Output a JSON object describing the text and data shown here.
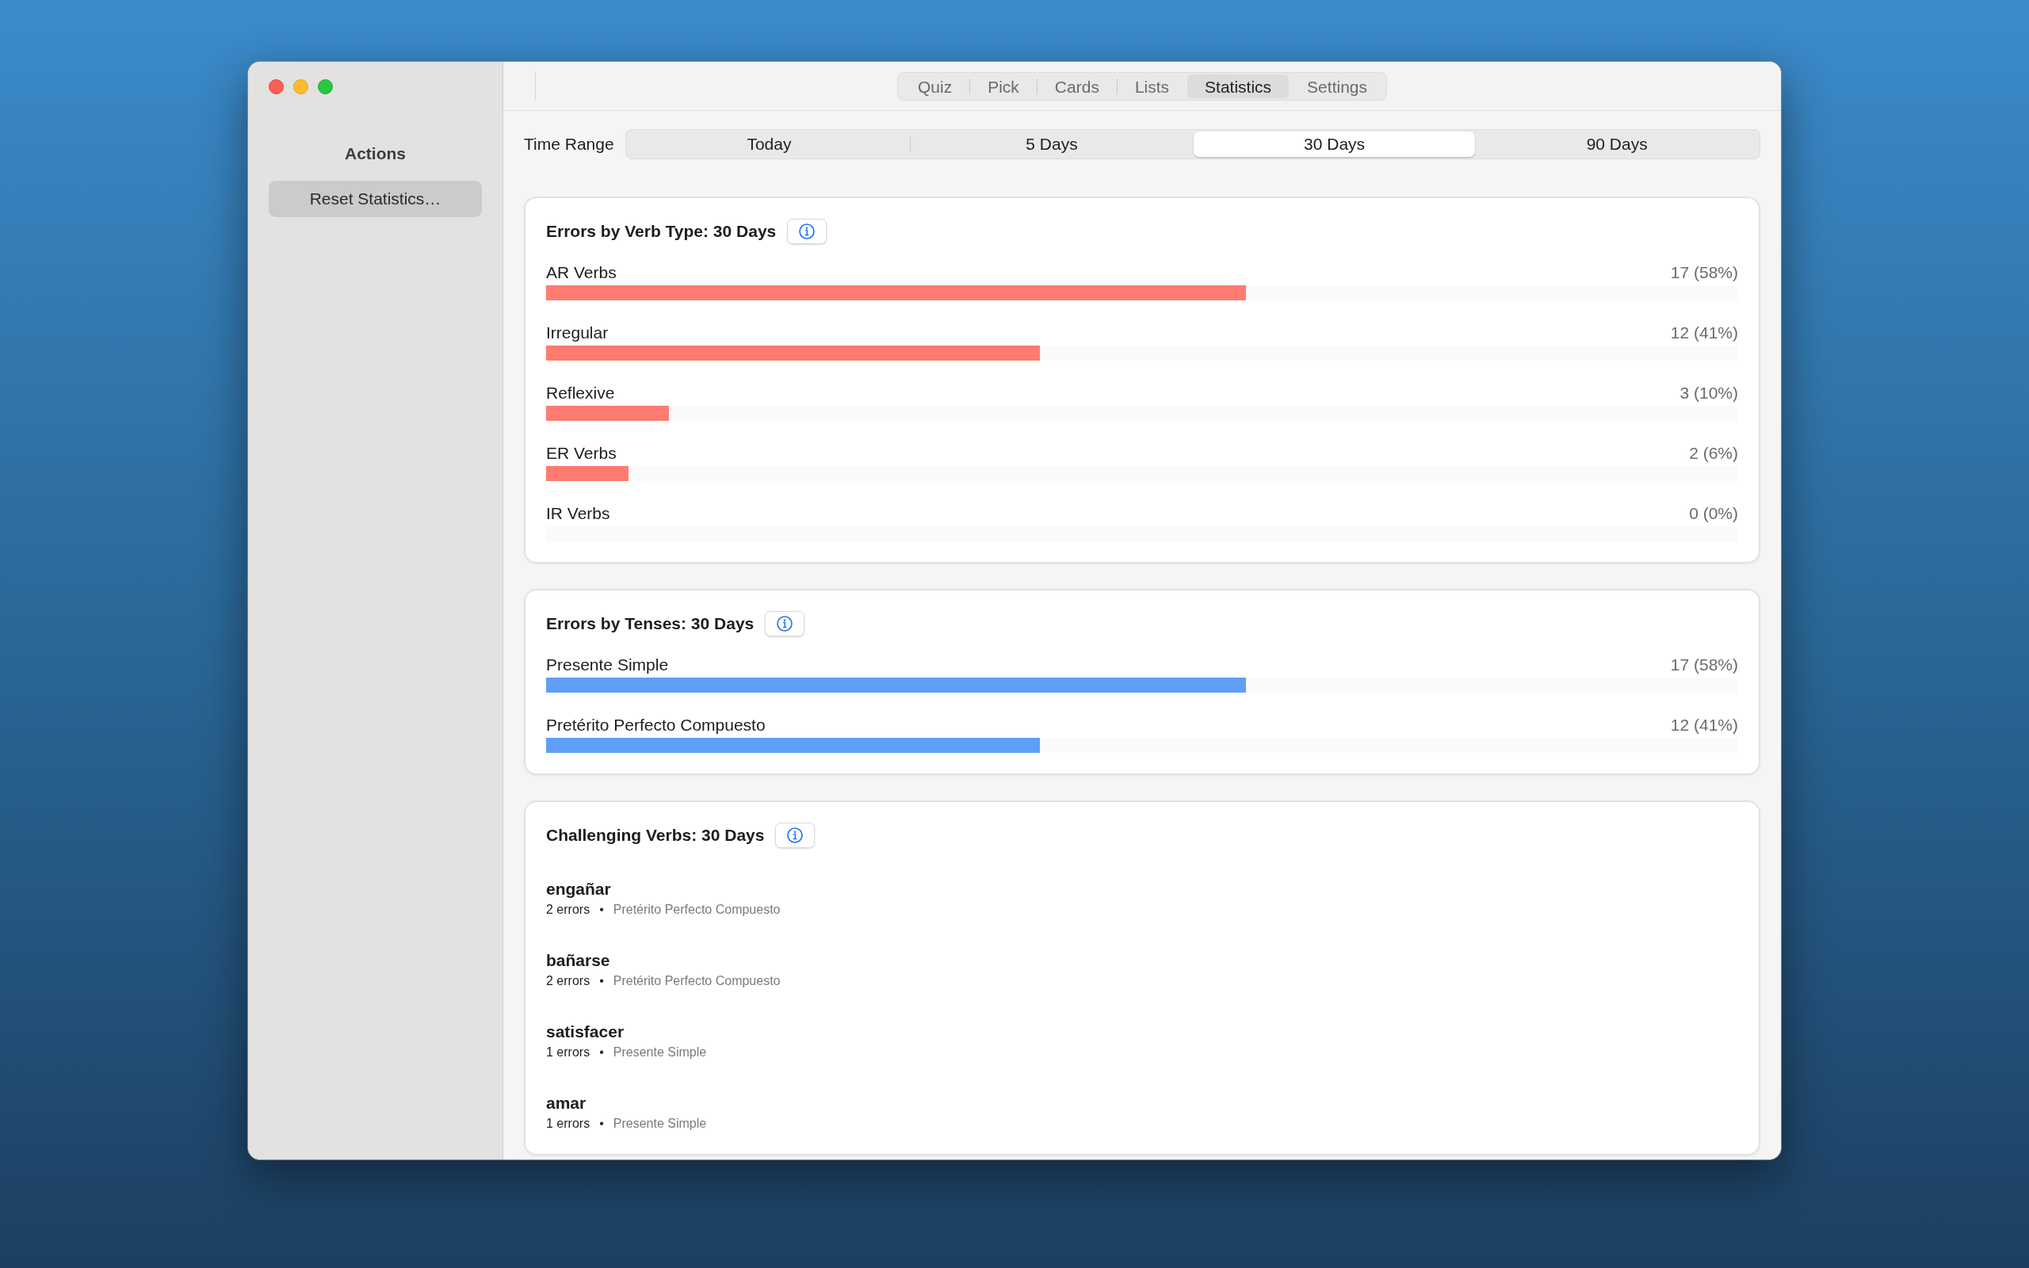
{
  "sidebar": {
    "heading": "Actions",
    "button": "Reset Statistics…"
  },
  "tabs": [
    {
      "label": "Quiz",
      "selected": false
    },
    {
      "label": "Pick",
      "selected": false
    },
    {
      "label": "Cards",
      "selected": false
    },
    {
      "label": "Lists",
      "selected": false
    },
    {
      "label": "Statistics",
      "selected": true
    },
    {
      "label": "Settings",
      "selected": false
    }
  ],
  "time_range": {
    "label": "Time Range",
    "options": [
      {
        "label": "Today",
        "selected": false
      },
      {
        "label": "5 Days",
        "selected": false
      },
      {
        "label": "30 Days",
        "selected": true
      },
      {
        "label": "90 Days",
        "selected": false
      }
    ]
  },
  "cards": [
    {
      "kind": "bars",
      "title": "Errors by Verb Type: 30 Days",
      "color": "#ff7b70",
      "rows": [
        {
          "label": "AR Verbs",
          "value": "17 (58%)",
          "level": 0.587
        },
        {
          "label": "Irregular",
          "value": "12 (41%)",
          "level": 0.414
        },
        {
          "label": "Reflexive",
          "value": "3 (10%)",
          "level": 0.103
        },
        {
          "label": "ER Verbs",
          "value": "2 (6%)",
          "level": 0.069
        },
        {
          "label": "IR Verbs",
          "value": "0 (0%)",
          "level": 0
        }
      ]
    },
    {
      "kind": "bars",
      "title": "Errors by Tenses: 30 Days",
      "color": "#5e9ff8",
      "rows": [
        {
          "label": "Presente Simple",
          "value": "17 (58%)",
          "level": 0.587
        },
        {
          "label": "Pretérito Perfecto Compuesto",
          "value": "12 (41%)",
          "level": 0.414
        }
      ]
    },
    {
      "kind": "verbs",
      "title": "Challenging Verbs: 30 Days",
      "verbs": [
        {
          "verb": "engañar",
          "errors": "2 errors",
          "bullet": "•",
          "tense": "Pretérito Perfecto Compuesto"
        },
        {
          "verb": "bañarse",
          "errors": "2 errors",
          "bullet": "•",
          "tense": "Pretérito Perfecto Compuesto"
        },
        {
          "verb": "satisfacer",
          "errors": "1 errors",
          "bullet": "•",
          "tense": "Presente Simple"
        },
        {
          "verb": "amar",
          "errors": "1 errors",
          "bullet": "•",
          "tense": "Presente Simple"
        }
      ]
    }
  ]
}
